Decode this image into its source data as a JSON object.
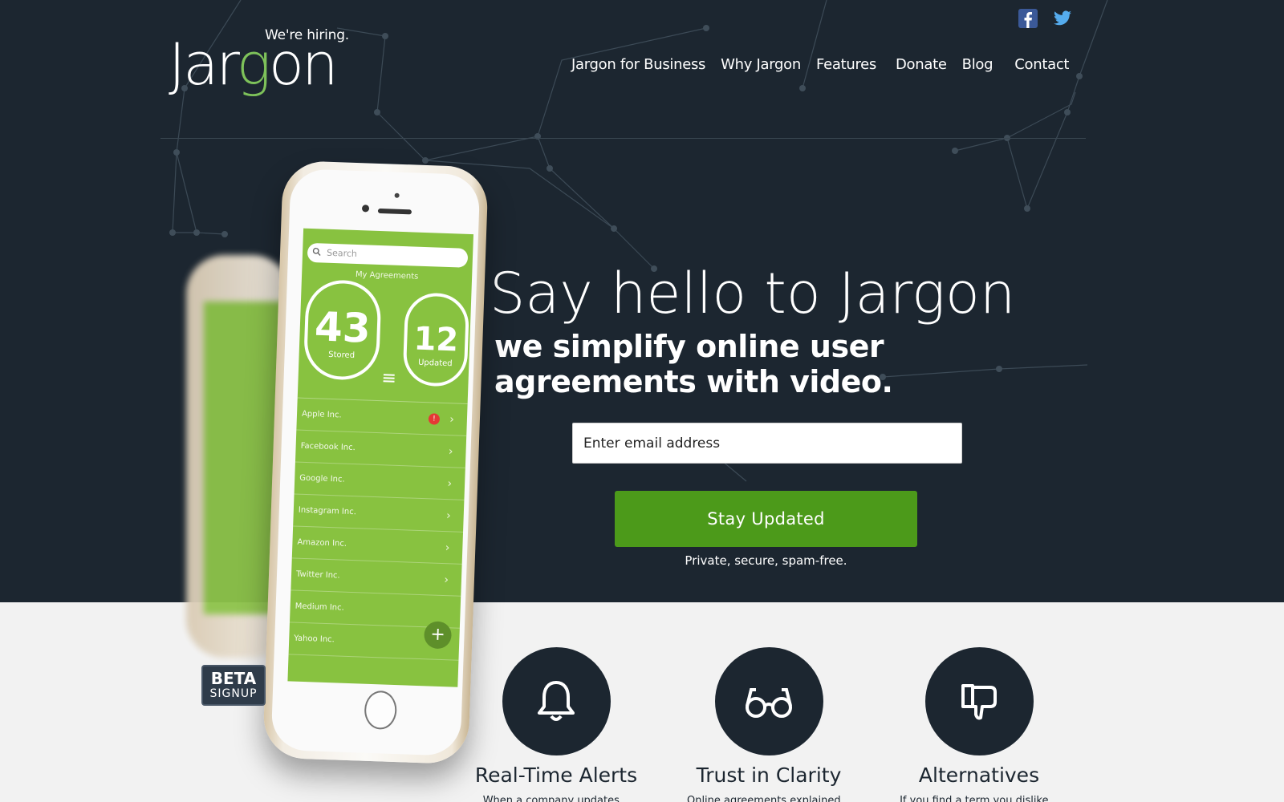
{
  "header": {
    "logo_text": "Jargon",
    "hiring_label": "We're hiring.",
    "social": [
      {
        "name": "facebook-icon",
        "label": "f",
        "color": "#3b5998"
      },
      {
        "name": "twitter-icon",
        "color": "#55acee"
      }
    ],
    "nav": [
      "Jargon for Business",
      "Why Jargon",
      "Features",
      "Donate",
      "Blog",
      "Contact"
    ]
  },
  "hero": {
    "headline": "Say hello to Jargon",
    "subheadline": "we simplify online user agreements with video.",
    "email_placeholder": "Enter email address",
    "cta_label": "Stay Updated",
    "privacy_note": "Private, secure, spam-free."
  },
  "phone_app": {
    "search_placeholder": "Search",
    "section_label": "My Agreements",
    "stored_count": "43",
    "stored_label": "Stored",
    "updated_count": "12",
    "updated_label": "Updated",
    "companies": [
      "Apple Inc.",
      "Facebook Inc.",
      "Google Inc.",
      "Instagram Inc.",
      "Amazon Inc.",
      "Twitter Inc.",
      "Medium Inc.",
      "Yahoo Inc."
    ],
    "alert_badge": "!",
    "fab_label": "+"
  },
  "beta": {
    "line1": "BETA",
    "line2": "SIGNUP"
  },
  "features": [
    {
      "icon": "bell-icon",
      "title": "Real-Time Alerts",
      "desc": "When a company updates..."
    },
    {
      "icon": "glasses-icon",
      "title": "Trust in Clarity",
      "desc": "Online agreements explained..."
    },
    {
      "icon": "thumbs-down-icon",
      "title": "Alternatives",
      "desc": "If you find a term you dislike..."
    }
  ],
  "colors": {
    "background_dark": "#1c2630",
    "accent_green": "#4c9a1a",
    "logo_green": "#7ec25a",
    "light_section": "#f2f2f2"
  }
}
